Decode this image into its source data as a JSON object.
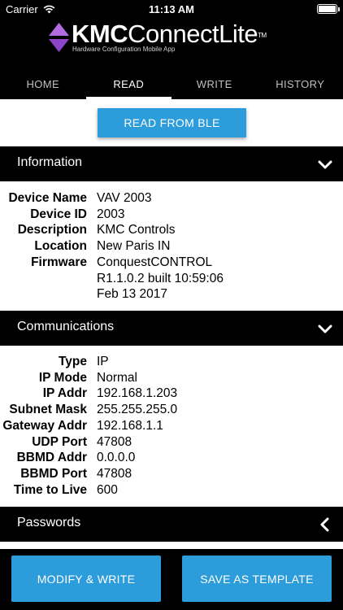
{
  "status": {
    "carrier": "Carrier",
    "time": "11:13 AM"
  },
  "header": {
    "brand_bold": "KMC",
    "brand_light": "ConnectLite",
    "brand_tm": "TM",
    "subtitle": "Hardware Configuration Mobile App"
  },
  "tabs": [
    {
      "label": "HOME"
    },
    {
      "label": "READ"
    },
    {
      "label": "WRITE"
    },
    {
      "label": "HISTORY"
    }
  ],
  "read_button": "READ FROM BLE",
  "information": {
    "title": "Information",
    "rows": [
      {
        "key": "Device Name",
        "value": "VAV 2003"
      },
      {
        "key": "Device ID",
        "value": "2003"
      },
      {
        "key": "Description",
        "value": "KMC Controls"
      },
      {
        "key": "Location",
        "value": "New Paris IN"
      },
      {
        "key": "Firmware",
        "value": "ConquestCONTROL"
      },
      {
        "key": "",
        "value": "R1.1.0.2  built 10:59:06"
      },
      {
        "key": "",
        "value": "Feb 13 2017"
      }
    ]
  },
  "communications": {
    "title": "Communications",
    "rows": [
      {
        "key": "Type",
        "value": "IP"
      },
      {
        "key": "IP Mode",
        "value": "Normal"
      },
      {
        "key": "IP Addr",
        "value": "192.168.1.203"
      },
      {
        "key": "Subnet Mask",
        "value": "255.255.255.0"
      },
      {
        "key": "Gateway Addr",
        "value": "192.168.1.1"
      },
      {
        "key": "UDP Port",
        "value": "47808"
      },
      {
        "key": "BBMD Addr",
        "value": "0.0.0.0"
      },
      {
        "key": "BBMD Port",
        "value": "47808"
      },
      {
        "key": "Time to Live",
        "value": "600"
      }
    ]
  },
  "passwords": {
    "title": "Passwords"
  },
  "bottom": {
    "modify_label": "MODIFY & WRITE",
    "save_label": "SAVE AS TEMPLATE"
  },
  "colors": {
    "accent": "#2d9cdb",
    "logo": "#a259d9",
    "bar": "#000000"
  }
}
